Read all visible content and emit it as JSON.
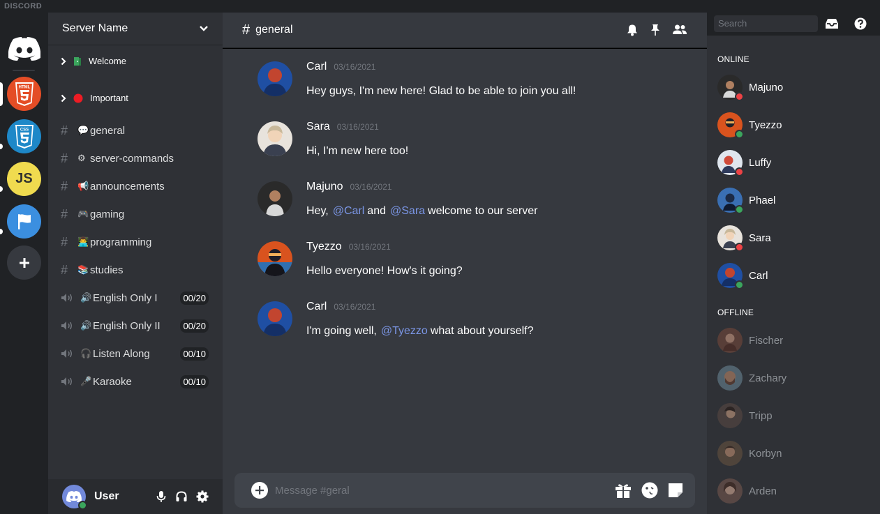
{
  "brand": "DISCORD",
  "colors": {
    "online": "#3ba55d",
    "dnd": "#ed4245",
    "mention": "#7b96e6",
    "accent": "#7289da"
  },
  "servers": [
    {
      "name": "home",
      "icon": "discord-logo-icon"
    },
    {
      "name": "html",
      "label": "HTML",
      "icon": "html5-icon"
    },
    {
      "name": "css",
      "label": "CSS",
      "icon": "css3-icon"
    },
    {
      "name": "js",
      "label": "JS"
    },
    {
      "name": "flag",
      "icon": "flag-icon"
    },
    {
      "name": "add",
      "icon": "plus-icon"
    }
  ],
  "sidebar": {
    "server_name": "Server Name",
    "categories": [
      {
        "label": "Welcome"
      },
      {
        "label": "Important"
      }
    ],
    "text_channels": [
      {
        "emoji": "💬",
        "label": "general"
      },
      {
        "emoji": "⚙",
        "label": "server-commands"
      },
      {
        "emoji": "📢",
        "label": "announcements"
      },
      {
        "emoji": "🎮",
        "label": "gaming"
      },
      {
        "emoji": "👨‍💻",
        "label": "programming"
      },
      {
        "emoji": "📚",
        "label": "studies"
      }
    ],
    "voice_channels": [
      {
        "emoji": "🔊",
        "label": "English Only I",
        "count": "00/20"
      },
      {
        "emoji": "🔊",
        "label": "English Only II",
        "count": "00/20"
      },
      {
        "emoji": "🎧",
        "label": "Listen Along",
        "count": "00/10"
      },
      {
        "emoji": "🎤",
        "label": "Karaoke",
        "count": "00/10"
      }
    ],
    "user": {
      "name": "User"
    }
  },
  "chat": {
    "channel": "general",
    "messages": [
      {
        "author": "Carl",
        "date": "03/16/2021",
        "text": "Hey guys, I'm new here! Glad to be able to join you all!",
        "color": "#1f4fa3"
      },
      {
        "author": "Sara",
        "date": "03/16/2021",
        "text": "Hi, I'm new here too!",
        "color": "#e8e3dc"
      },
      {
        "author": "Majuno",
        "date": "03/16/2021",
        "text_before": "Hey,",
        "mention1": "@Carl",
        "text_mid": "and",
        "mention2": "@Sara",
        "text_after": "welcome to our server",
        "color": "#2a2a2a"
      },
      {
        "author": "Tyezzo",
        "date": "03/16/2021",
        "text": "Hello everyone! How's it going?",
        "color": "#d9531e"
      },
      {
        "author": "Carl",
        "date": "03/16/2021",
        "text_before": "I'm going well,",
        "mention1": "@Tyezzo",
        "text_after": "what about yourself?",
        "color": "#1f4fa3"
      }
    ],
    "composer_placeholder": "Message #geral"
  },
  "members": {
    "search_placeholder": "Search",
    "online_label": "ONLINE",
    "offline_label": "OFFLINE",
    "online": [
      {
        "name": "Majuno",
        "status": "dnd",
        "color": "#2a2a2a"
      },
      {
        "name": "Tyezzo",
        "status": "online",
        "color": "#d9531e"
      },
      {
        "name": "Luffy",
        "status": "dnd",
        "color": "#e0e6ee"
      },
      {
        "name": "Phael",
        "status": "online",
        "color": "#3a6fb3"
      },
      {
        "name": "Sara",
        "status": "dnd",
        "color": "#e8e3dc"
      },
      {
        "name": "Carl",
        "status": "online",
        "color": "#1f4fa3"
      }
    ],
    "offline": [
      {
        "name": "Fischer",
        "color": "#7a4a3a"
      },
      {
        "name": "Zachary",
        "color": "#6e8a9a"
      },
      {
        "name": "Tripp",
        "color": "#5c4a44"
      },
      {
        "name": "Korbyn",
        "color": "#6a5440"
      },
      {
        "name": "Arden",
        "color": "#7a5a50"
      }
    ]
  }
}
